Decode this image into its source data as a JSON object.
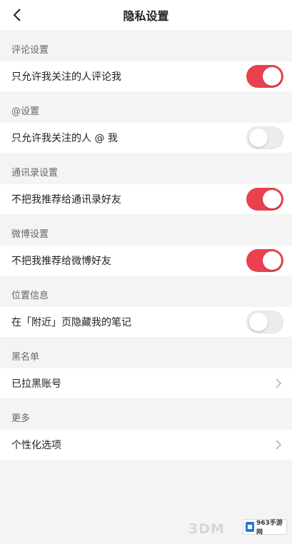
{
  "header": {
    "title": "隐私设置"
  },
  "sections": [
    {
      "label": "评论设置",
      "row": {
        "label": "只允许我关注的人评论我",
        "control": "toggle",
        "on": true
      }
    },
    {
      "label": "@设置",
      "row": {
        "label": "只允许我关注的人 @ 我",
        "control": "toggle",
        "on": false
      }
    },
    {
      "label": "通讯录设置",
      "row": {
        "label": "不把我推荐给通讯录好友",
        "control": "toggle",
        "on": true
      }
    },
    {
      "label": "微博设置",
      "row": {
        "label": "不把我推荐给微博好友",
        "control": "toggle",
        "on": true
      }
    },
    {
      "label": "位置信息",
      "row": {
        "label": "在「附近」页隐藏我的笔记",
        "control": "toggle",
        "on": false
      }
    },
    {
      "label": "黑名单",
      "row": {
        "label": "已拉黑账号",
        "control": "chevron"
      }
    },
    {
      "label": "更多",
      "row": {
        "label": "个性化选项",
        "control": "chevron"
      }
    }
  ],
  "watermark": {
    "site": "963手游网",
    "brand": "3DM"
  },
  "colors": {
    "toggle_on": "#e9414e",
    "toggle_off": "#ececec",
    "background": "#f4f4f4"
  }
}
